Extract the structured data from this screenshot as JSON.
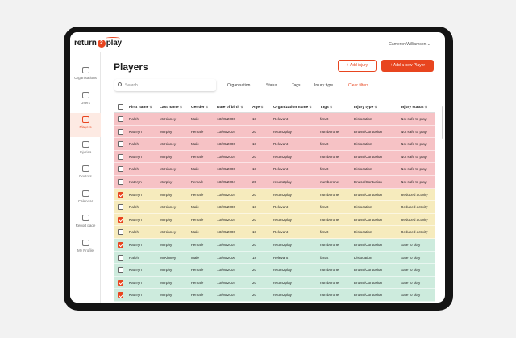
{
  "app": {
    "logo_text_a": "return",
    "logo_text_b": "2",
    "logo_text_c": "play",
    "user_menu": "Cameron Williamson ⌄"
  },
  "sidebar": {
    "items": [
      {
        "label": "Organisations",
        "icon": "building-icon",
        "active": false
      },
      {
        "label": "Users",
        "icon": "users-icon",
        "active": false
      },
      {
        "label": "Players",
        "icon": "players-icon",
        "active": true
      },
      {
        "label": "Injuries",
        "icon": "injury-icon",
        "active": false
      },
      {
        "label": "Doctors",
        "icon": "doctor-icon",
        "active": false
      },
      {
        "label": "Calendar",
        "icon": "calendar-icon",
        "active": false
      },
      {
        "label": "Report page",
        "icon": "report-icon",
        "active": false
      },
      {
        "label": "My Profile",
        "icon": "profile-icon",
        "active": false
      }
    ]
  },
  "page": {
    "title": "Players",
    "add_injury": "+ Add injury",
    "add_player": "+ Add a new Player"
  },
  "search": {
    "placeholder": "Search"
  },
  "filters": {
    "organisation": "Organisation",
    "status": "Status",
    "tags": "Tags",
    "injury_type": "Injury type",
    "clear": "Clear filters"
  },
  "table": {
    "headers": {
      "first_name": "First name",
      "last_name": "Last name",
      "gender": "Gender",
      "dob": "Date of birth",
      "age": "Age",
      "org": "Organization name",
      "tags": "Tags",
      "injury_type": "Injury type",
      "injury_status": "Injury status"
    },
    "rows": [
      {
        "first": "Ralph",
        "last": "McKinney",
        "gender": "Male",
        "dob": "13/09/2006",
        "age": "18",
        "org": "Relevant",
        "tags": "fanat",
        "injury": "Dislocation",
        "status": "Not safe to play",
        "checked": false,
        "tone": "notsafe"
      },
      {
        "first": "Kathryn",
        "last": "Murphy",
        "gender": "Female",
        "dob": "13/09/2004",
        "age": "20",
        "org": "return2play",
        "tags": "numberone",
        "injury": "Bruise/Contusion",
        "status": "Not safe to play",
        "checked": false,
        "tone": "notsafe"
      },
      {
        "first": "Ralph",
        "last": "McKinney",
        "gender": "Male",
        "dob": "13/09/2006",
        "age": "18",
        "org": "Relevant",
        "tags": "fanat",
        "injury": "Dislocation",
        "status": "Not safe to play",
        "checked": false,
        "tone": "notsafe"
      },
      {
        "first": "Kathryn",
        "last": "Murphy",
        "gender": "Female",
        "dob": "13/09/2004",
        "age": "20",
        "org": "return2play",
        "tags": "numberone",
        "injury": "Bruise/Contusion",
        "status": "Not safe to play",
        "checked": false,
        "tone": "notsafe"
      },
      {
        "first": "Ralph",
        "last": "McKinney",
        "gender": "Male",
        "dob": "13/09/2006",
        "age": "18",
        "org": "Relevant",
        "tags": "fanat",
        "injury": "Dislocation",
        "status": "Not safe to play",
        "checked": false,
        "tone": "notsafe"
      },
      {
        "first": "Kathryn",
        "last": "Murphy",
        "gender": "Female",
        "dob": "13/09/2004",
        "age": "20",
        "org": "return2play",
        "tags": "numberone",
        "injury": "Bruise/Contusion",
        "status": "Not safe to play",
        "checked": false,
        "tone": "notsafe"
      },
      {
        "first": "Kathryn",
        "last": "Murphy",
        "gender": "Female",
        "dob": "13/09/2004",
        "age": "20",
        "org": "return2play",
        "tags": "numberone",
        "injury": "Bruise/Contusion",
        "status": "Reduced activity",
        "checked": true,
        "tone": "reduced"
      },
      {
        "first": "Ralph",
        "last": "McKinney",
        "gender": "Male",
        "dob": "13/09/2006",
        "age": "18",
        "org": "Relevant",
        "tags": "fanat",
        "injury": "Dislocation",
        "status": "Reduced activity",
        "checked": false,
        "tone": "reduced"
      },
      {
        "first": "Kathryn",
        "last": "Murphy",
        "gender": "Female",
        "dob": "13/09/2004",
        "age": "20",
        "org": "return2play",
        "tags": "numberone",
        "injury": "Bruise/Contusion",
        "status": "Reduced activity",
        "checked": true,
        "tone": "reduced"
      },
      {
        "first": "Ralph",
        "last": "McKinney",
        "gender": "Male",
        "dob": "13/09/2006",
        "age": "18",
        "org": "Relevant",
        "tags": "fanat",
        "injury": "Dislocation",
        "status": "Reduced activity",
        "checked": false,
        "tone": "reduced"
      },
      {
        "first": "Kathryn",
        "last": "Murphy",
        "gender": "Female",
        "dob": "13/09/2004",
        "age": "20",
        "org": "return2play",
        "tags": "numberone",
        "injury": "Bruise/Contusion",
        "status": "Safe to play",
        "checked": true,
        "tone": "safe"
      },
      {
        "first": "Ralph",
        "last": "McKinney",
        "gender": "Male",
        "dob": "13/09/2006",
        "age": "18",
        "org": "Relevant",
        "tags": "fanat",
        "injury": "Dislocation",
        "status": "Safe to play",
        "checked": false,
        "tone": "safe"
      },
      {
        "first": "Kathryn",
        "last": "Murphy",
        "gender": "Female",
        "dob": "13/09/2004",
        "age": "20",
        "org": "return2play",
        "tags": "numberone",
        "injury": "Bruise/Contusion",
        "status": "Safe to play",
        "checked": false,
        "tone": "safe"
      },
      {
        "first": "Kathryn",
        "last": "Murphy",
        "gender": "Female",
        "dob": "13/09/2004",
        "age": "20",
        "org": "return2play",
        "tags": "numberone",
        "injury": "Bruise/Contusion",
        "status": "Safe to play",
        "checked": true,
        "tone": "safe"
      },
      {
        "first": "Kathryn",
        "last": "Murphy",
        "gender": "Female",
        "dob": "13/09/2004",
        "age": "20",
        "org": "return2play",
        "tags": "numberone",
        "injury": "Bruise/Contusion",
        "status": "Safe to play",
        "checked": true,
        "tone": "safe"
      }
    ]
  },
  "colors": {
    "accent": "#e8451f",
    "not_safe": "#f6c2c5",
    "reduced": "#f6ebbd",
    "safe": "#cdebdd"
  }
}
